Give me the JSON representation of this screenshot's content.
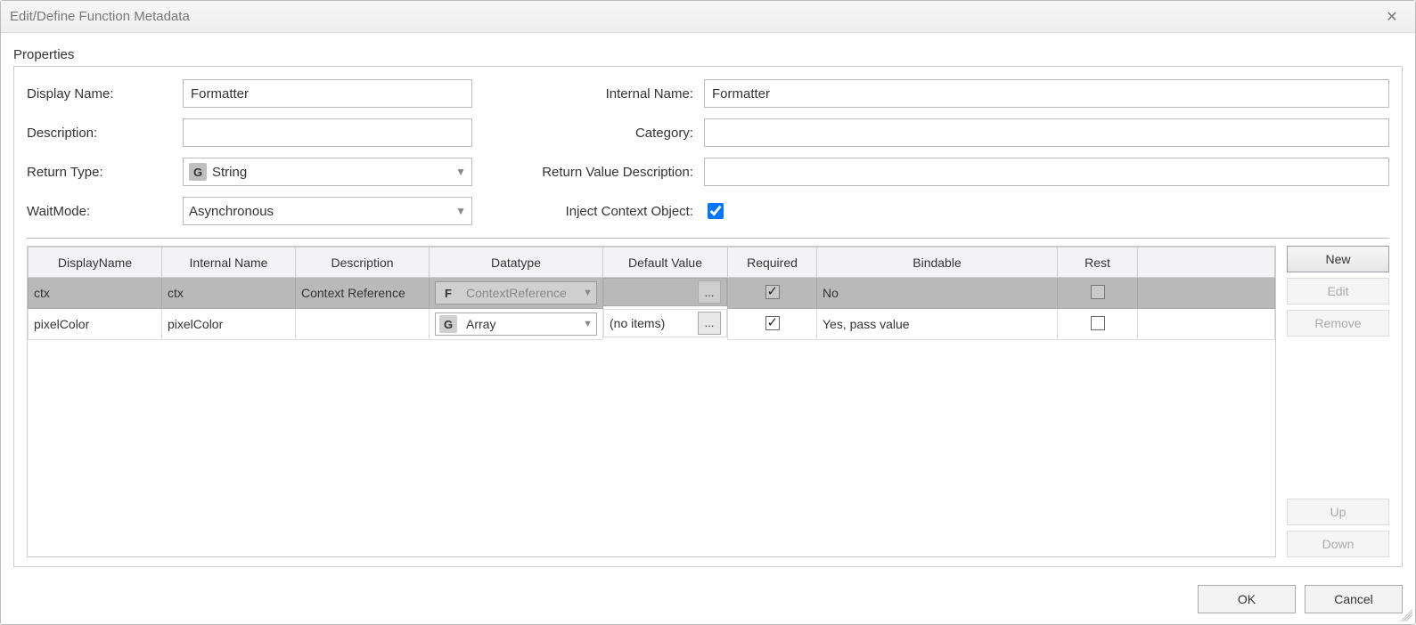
{
  "title": "Edit/Define Function Metadata",
  "section_label": "Properties",
  "labels": {
    "display_name": "Display Name:",
    "description": "Description:",
    "return_type": "Return Type:",
    "wait_mode": "WaitMode:",
    "internal_name": "Internal Name:",
    "category": "Category:",
    "return_value_description": "Return Value Description:",
    "inject_context_object": "Inject Context Object:"
  },
  "values": {
    "display_name": "Formatter",
    "description": "",
    "return_type": "String",
    "return_type_badge": "G",
    "wait_mode": "Asynchronous",
    "internal_name": "Formatter",
    "category": "",
    "return_value_description": "",
    "inject_context_object": true
  },
  "table": {
    "columns": [
      "DisplayName",
      "Internal Name",
      "Description",
      "Datatype",
      "Default Value",
      "Required",
      "Bindable",
      "Rest",
      ""
    ],
    "rows": [
      {
        "selected": true,
        "display_name": "ctx",
        "internal_name": "ctx",
        "description": "Context Reference",
        "datatype_badge": "F",
        "datatype": "ContextReference",
        "default_value": "",
        "default_value_btn": "...",
        "required": true,
        "bindable": "No",
        "rest": false
      },
      {
        "selected": false,
        "display_name": "pixelColor",
        "internal_name": "pixelColor",
        "description": "",
        "datatype_badge": "G",
        "datatype": "Array",
        "default_value": "(no items)",
        "default_value_btn": "...",
        "required": true,
        "bindable": "Yes, pass value",
        "rest": false
      }
    ]
  },
  "side_buttons": {
    "new": "New",
    "edit": "Edit",
    "remove": "Remove",
    "up": "Up",
    "down": "Down"
  },
  "footer": {
    "ok": "OK",
    "cancel": "Cancel"
  }
}
